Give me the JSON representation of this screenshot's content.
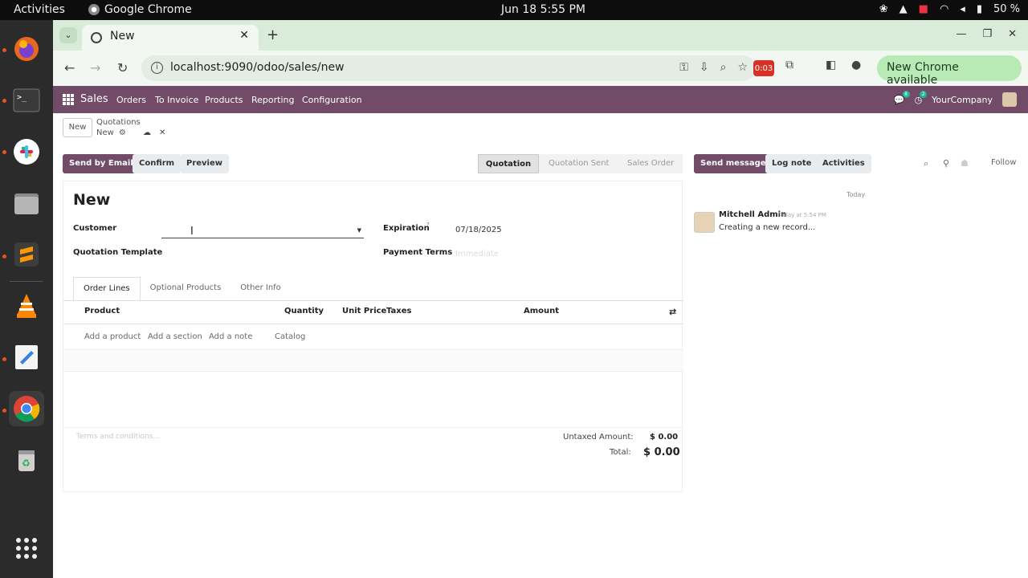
{
  "os": {
    "activities": "Activities",
    "app_name": "Google Chrome",
    "clock": "Jun 18  5:55 PM",
    "battery": "50 %"
  },
  "browser": {
    "tab_title": "New",
    "url": "localhost:9090/odoo/sales/new",
    "recording_badge": "0:03",
    "update_button": "New Chrome available"
  },
  "odoo_nav": {
    "app": "Sales",
    "menu": [
      "Orders",
      "To Invoice",
      "Products",
      "Reporting",
      "Configuration"
    ],
    "messages_count": "8",
    "activities_count": "2",
    "company": "YourCompany"
  },
  "control_panel": {
    "new_button": "New",
    "breadcrumb_parent": "Quotations",
    "breadcrumb_current": "New"
  },
  "actions": {
    "send_email": "Send by Email",
    "confirm": "Confirm",
    "preview": "Preview"
  },
  "status": {
    "stages": [
      "Quotation",
      "Quotation Sent",
      "Sales Order"
    ],
    "active": "Quotation"
  },
  "form": {
    "title": "New",
    "customer_label": "Customer",
    "customer_value": "",
    "template_label": "Quotation Template",
    "expiration_label": "Expiration",
    "expiration_help": "?",
    "expiration_value": "07/18/2025",
    "payment_terms_label": "Payment Terms",
    "payment_terms_placeholder": "Immediate",
    "tabs": [
      "Order Lines",
      "Optional Products",
      "Other Info"
    ],
    "active_tab": "Order Lines",
    "columns": [
      "Product",
      "Quantity",
      "Unit Price",
      "Taxes",
      "Amount"
    ],
    "add_product": "Add a product",
    "add_section": "Add a section",
    "add_note": "Add a note",
    "catalog": "Catalog",
    "terms_placeholder": "Terms and conditions...",
    "untaxed_label": "Untaxed Amount:",
    "untaxed_value": "$ 0.00",
    "total_label": "Total:",
    "total_value": "$ 0.00"
  },
  "chatter": {
    "send_message": "Send message",
    "log_note": "Log note",
    "activities": "Activities",
    "follow": "Follow",
    "day_separator": "Today",
    "message_author": "Mitchell Admin",
    "message_date": "Today at 5:54 PM",
    "message_body": "Creating a new record..."
  }
}
